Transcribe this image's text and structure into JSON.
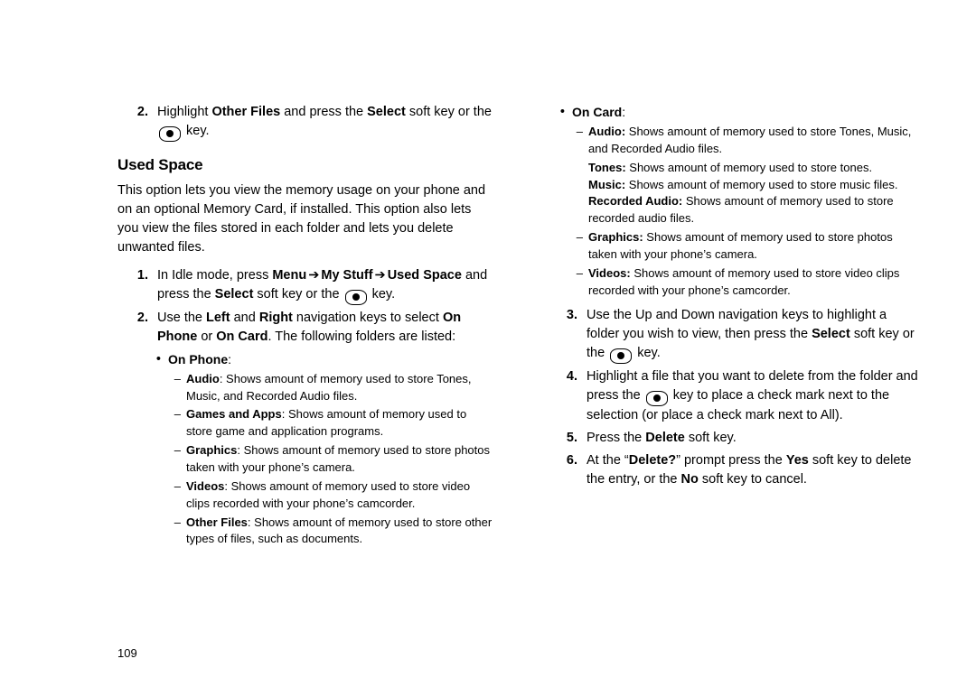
{
  "page_number": "109",
  "left": {
    "top_step": {
      "num": "2.",
      "pre": "Highlight ",
      "b1": "Other Files",
      "mid": " and press the ",
      "b2": "Select",
      "post": " soft key or the ",
      "tail": " key."
    },
    "heading": "Used Space",
    "intro": "This option lets you view the memory usage on your phone and on an optional Memory Card, if installed. This option also lets you view the files stored in each folder and lets you delete unwanted files.",
    "step1": {
      "num": "1.",
      "t1": "In Idle mode, press ",
      "b1": "Menu",
      "arrow1": " ➔ ",
      "b2": "My Stuff",
      "arrow2": " ➔ ",
      "b3": "Used Space",
      "t2": " and press the ",
      "b4": "Select",
      "t3": " soft key or the ",
      "t4": " key."
    },
    "step2": {
      "num": "2.",
      "t1": "Use the ",
      "b1": "Left",
      "t2": " and ",
      "b2": "Right",
      "t3": " navigation keys to select ",
      "b3": "On Phone",
      "t4": " or ",
      "b4": "On Card",
      "t5": ". The following folders are listed:"
    },
    "onphone_label": "On Phone",
    "onphone": {
      "audio": {
        "b": "Audio",
        "t": ": Shows amount of memory used to store Tones, Music, and Recorded Audio files."
      },
      "games": {
        "b": "Games and Apps",
        "t": ": Shows amount of memory used to store game and application programs."
      },
      "graphics": {
        "b": "Graphics",
        "t": ": Shows amount of memory used to store photos taken with your phone’s camera."
      },
      "videos": {
        "b": "Videos",
        "t": ": Shows amount of memory used to store video clips recorded with your phone’s camcorder."
      },
      "other": {
        "b": "Other Files",
        "t": ": Shows amount of memory used to store other types of files, such as documents."
      }
    }
  },
  "right": {
    "oncard_label": "On Card",
    "oncard": {
      "audio": {
        "b": "Audio:",
        "t": " Shows amount of memory used to store Tones, Music, and Recorded Audio files."
      },
      "tones": {
        "b": "Tones:",
        "t": "  Shows amount of memory used to store tones."
      },
      "music": {
        "b": "Music:",
        "t": "  Shows amount of memory used to store music files."
      },
      "recaudio": {
        "b": "Recorded Audio:",
        "t": "  Shows amount of memory used to store recorded audio files."
      },
      "graphics": {
        "b": "Graphics:",
        "t": "  Shows amount of memory used to store photos taken with your phone’s camera."
      },
      "videos": {
        "b": "Videos:",
        "t": "  Shows amount of memory used to store video clips recorded with your phone’s camcorder."
      }
    },
    "step3": {
      "num": "3.",
      "t1": "Use the Up and Down navigation keys to highlight a folder you wish to view, then press the ",
      "b1": "Select",
      "t2": " soft key or the ",
      "t3": " key."
    },
    "step4": {
      "num": "4.",
      "t1": "Highlight a file that you want to delete from the folder and press the ",
      "t2": " key to place a check mark next to the selection (or place a check mark next to All)."
    },
    "step5": {
      "num": "5.",
      "t1": "Press the ",
      "b1": "Delete",
      "t2": " soft key."
    },
    "step6": {
      "num": "6.",
      "t1": "At the “",
      "b1": "Delete?",
      "t2": "” prompt press the ",
      "b2": "Yes",
      "t3": " soft key to delete the entry, or the ",
      "b3": "No",
      "t4": " soft key to cancel."
    }
  }
}
